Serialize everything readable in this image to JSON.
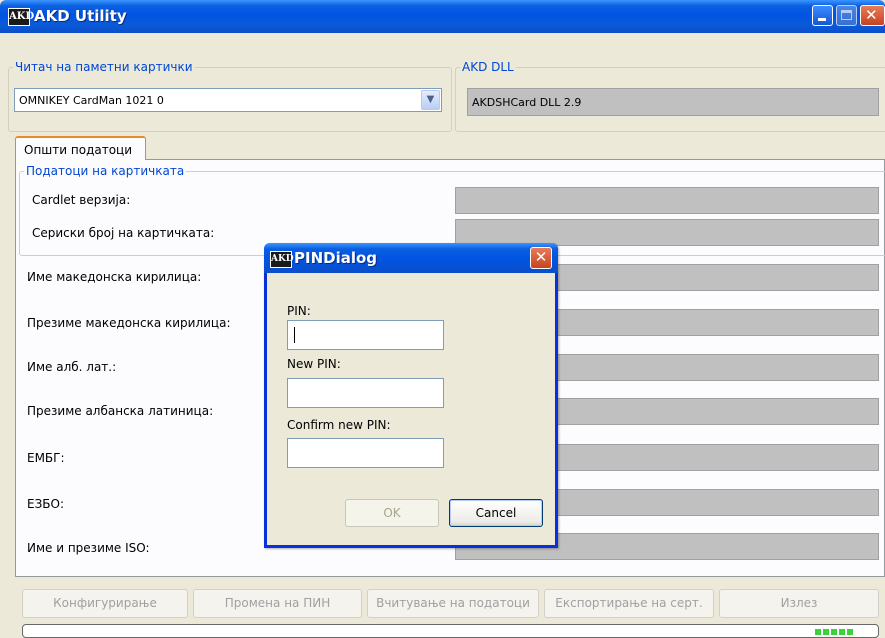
{
  "window": {
    "title": "AKD Utility",
    "logo": "AKD"
  },
  "reader_group": {
    "legend": "Читач на паметни картички",
    "selected": "OMNIKEY CardMan 1021 0"
  },
  "dll_group": {
    "legend": "AKD DLL",
    "value": "AKDSHCard DLL 2.9"
  },
  "tabs": [
    {
      "label": "Општи податоци"
    }
  ],
  "card_group": {
    "legend": "Податоци на картичката"
  },
  "fields": {
    "cardlet": "Cardlet верзија:",
    "serial": "Сериски број на картичката:",
    "name_mk": "Име македонска кирилица:",
    "surname_mk": "Презиме македонска кирилица:",
    "name_al": "Име алб. лат.:",
    "surname_al": "Презиме албанска латиница:",
    "embg": "ЕМБГ:",
    "ezbo": "ЕЗБО:",
    "name_iso": "Име и презиме ISO:"
  },
  "buttons": {
    "configure": "Конфигурирање",
    "change_pin": "Промена на ПИН",
    "read_data": "Вчитување на податоци",
    "export_cert": "Експортирање на серт.",
    "exit": "Излез"
  },
  "dialog": {
    "title": "PINDialog",
    "logo": "AKD",
    "pin_label": "PIN:",
    "new_pin_label": "New PIN:",
    "confirm_label": "Confirm new PIN:",
    "ok": "OK",
    "cancel": "Cancel"
  }
}
